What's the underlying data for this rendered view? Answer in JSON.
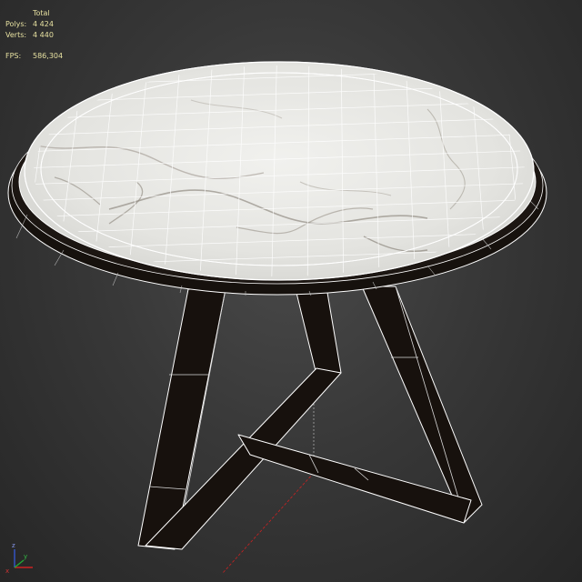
{
  "viewport": {
    "stats": {
      "header": "Total",
      "polys_label": "Polys:",
      "polys_value": "4 424",
      "verts_label": "Verts:",
      "verts_value": "4 440",
      "fps_label": "FPS:",
      "fps_value": "586,304"
    },
    "colors": {
      "stats_text": "#e6e0a0",
      "background": "#3a3a3a",
      "marble": "#e9e9e6",
      "frame": "#1a1410",
      "wire": "#ffffff",
      "axis_x": "#cc2222",
      "axis_y": "#22aa33",
      "axis_z": "#3355cc"
    },
    "object": "marble-round-table"
  }
}
